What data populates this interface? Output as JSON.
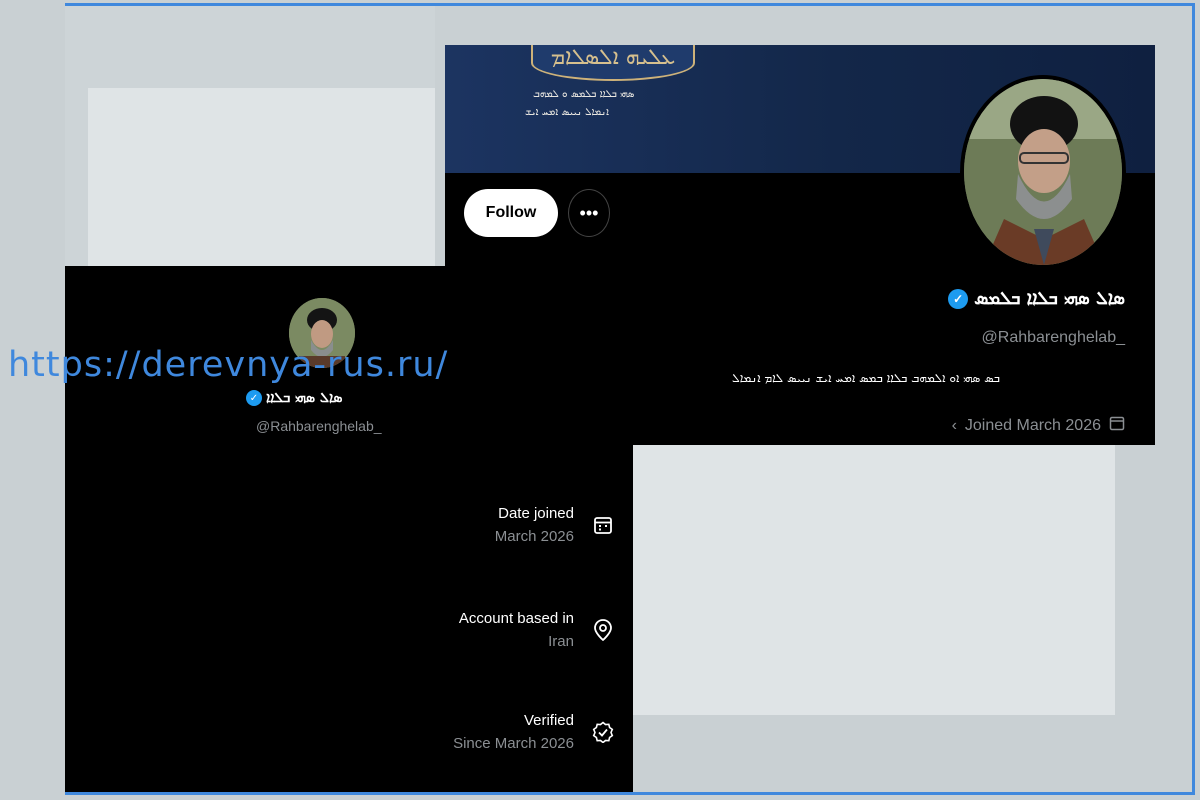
{
  "watermark": {
    "url": "https://derevnya-rus.ru/"
  },
  "profile": {
    "name": "ܣܐܠ ܣܗܝ ܒܠܐܐ ܒܠܡܣ",
    "handle": "@Rahbarenghelab_",
    "bio": "ܒܣ ܣܗܝ ܐܘ ܐܠܡܗܒ ܒܠܐܐ ܒܡܣ ܐܡܚ ܐܝܫ ܢܝܝܣ ܠܐܡ ܐܢܡܐܠ",
    "joined": "Joined March 2026",
    "follow_label": "Follow",
    "more_label": "•••",
    "banner_ornament": "ܥܠܝܗ ܐܠܣܠܐܡ",
    "banner_line_1": "ܣܗܝ ܒܠܐܐ ܒܠܡܣ ܘ ܠܡܗܒ",
    "banner_line_2": "ܐܢܡܐܠ ܢܝܝܣ ܐܡܚ ܐܝܫ"
  },
  "small_profile": {
    "name": "ܣܐܠ ܣܗܝ ܒܠܐܐ",
    "handle": "@Rahbarenghelab_"
  },
  "about": {
    "items": [
      {
        "label": "Date joined",
        "value": "March 2026",
        "icon": "calendar-icon"
      },
      {
        "label": "Account based in",
        "value": "Iran",
        "icon": "location-pin-icon"
      },
      {
        "label": "Verified",
        "value": "Since March 2026",
        "icon": "verified-seal-icon"
      }
    ]
  },
  "colors": {
    "accent_blue": "#1d9bf0",
    "frame_blue": "#3f88dd",
    "banner_navy": "#132749"
  }
}
